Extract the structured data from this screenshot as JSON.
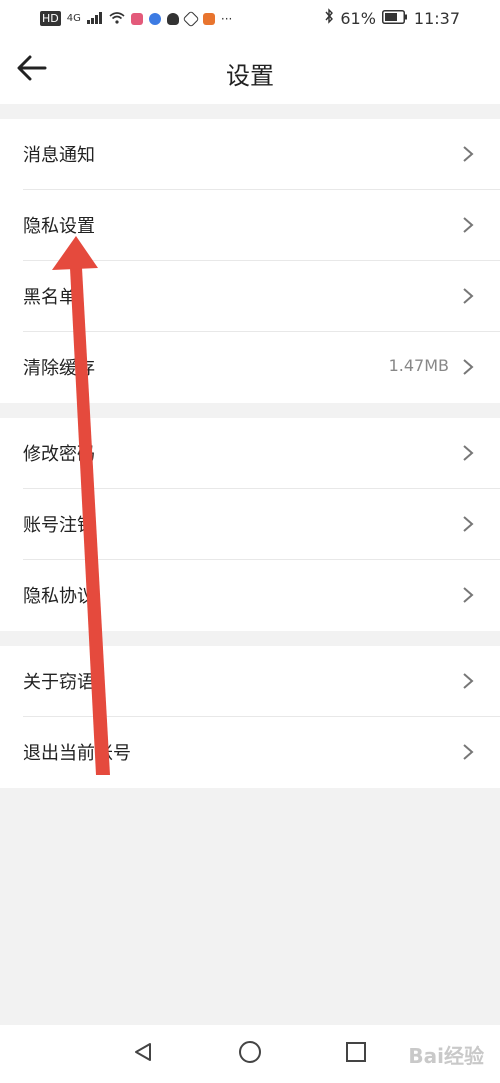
{
  "status_bar": {
    "left_label": "HD",
    "signal_label": "4G",
    "battery": "61%",
    "time": "11:37",
    "more": "···"
  },
  "header": {
    "title": "设置"
  },
  "sections": [
    {
      "items": [
        {
          "label": "消息通知"
        },
        {
          "label": "隐私设置"
        },
        {
          "label": "黑名单"
        },
        {
          "label": "清除缓存",
          "value": "1.47MB"
        }
      ]
    },
    {
      "items": [
        {
          "label": "修改密码"
        },
        {
          "label": "账号注销"
        },
        {
          "label": "隐私协议"
        }
      ]
    },
    {
      "items": [
        {
          "label": "关于窃语"
        },
        {
          "label": "退出当前账号"
        }
      ]
    }
  ],
  "watermark": "Bai经验",
  "colors": {
    "arrow": "#e54a3d",
    "background": "#f2f2f2",
    "surface": "#ffffff"
  }
}
